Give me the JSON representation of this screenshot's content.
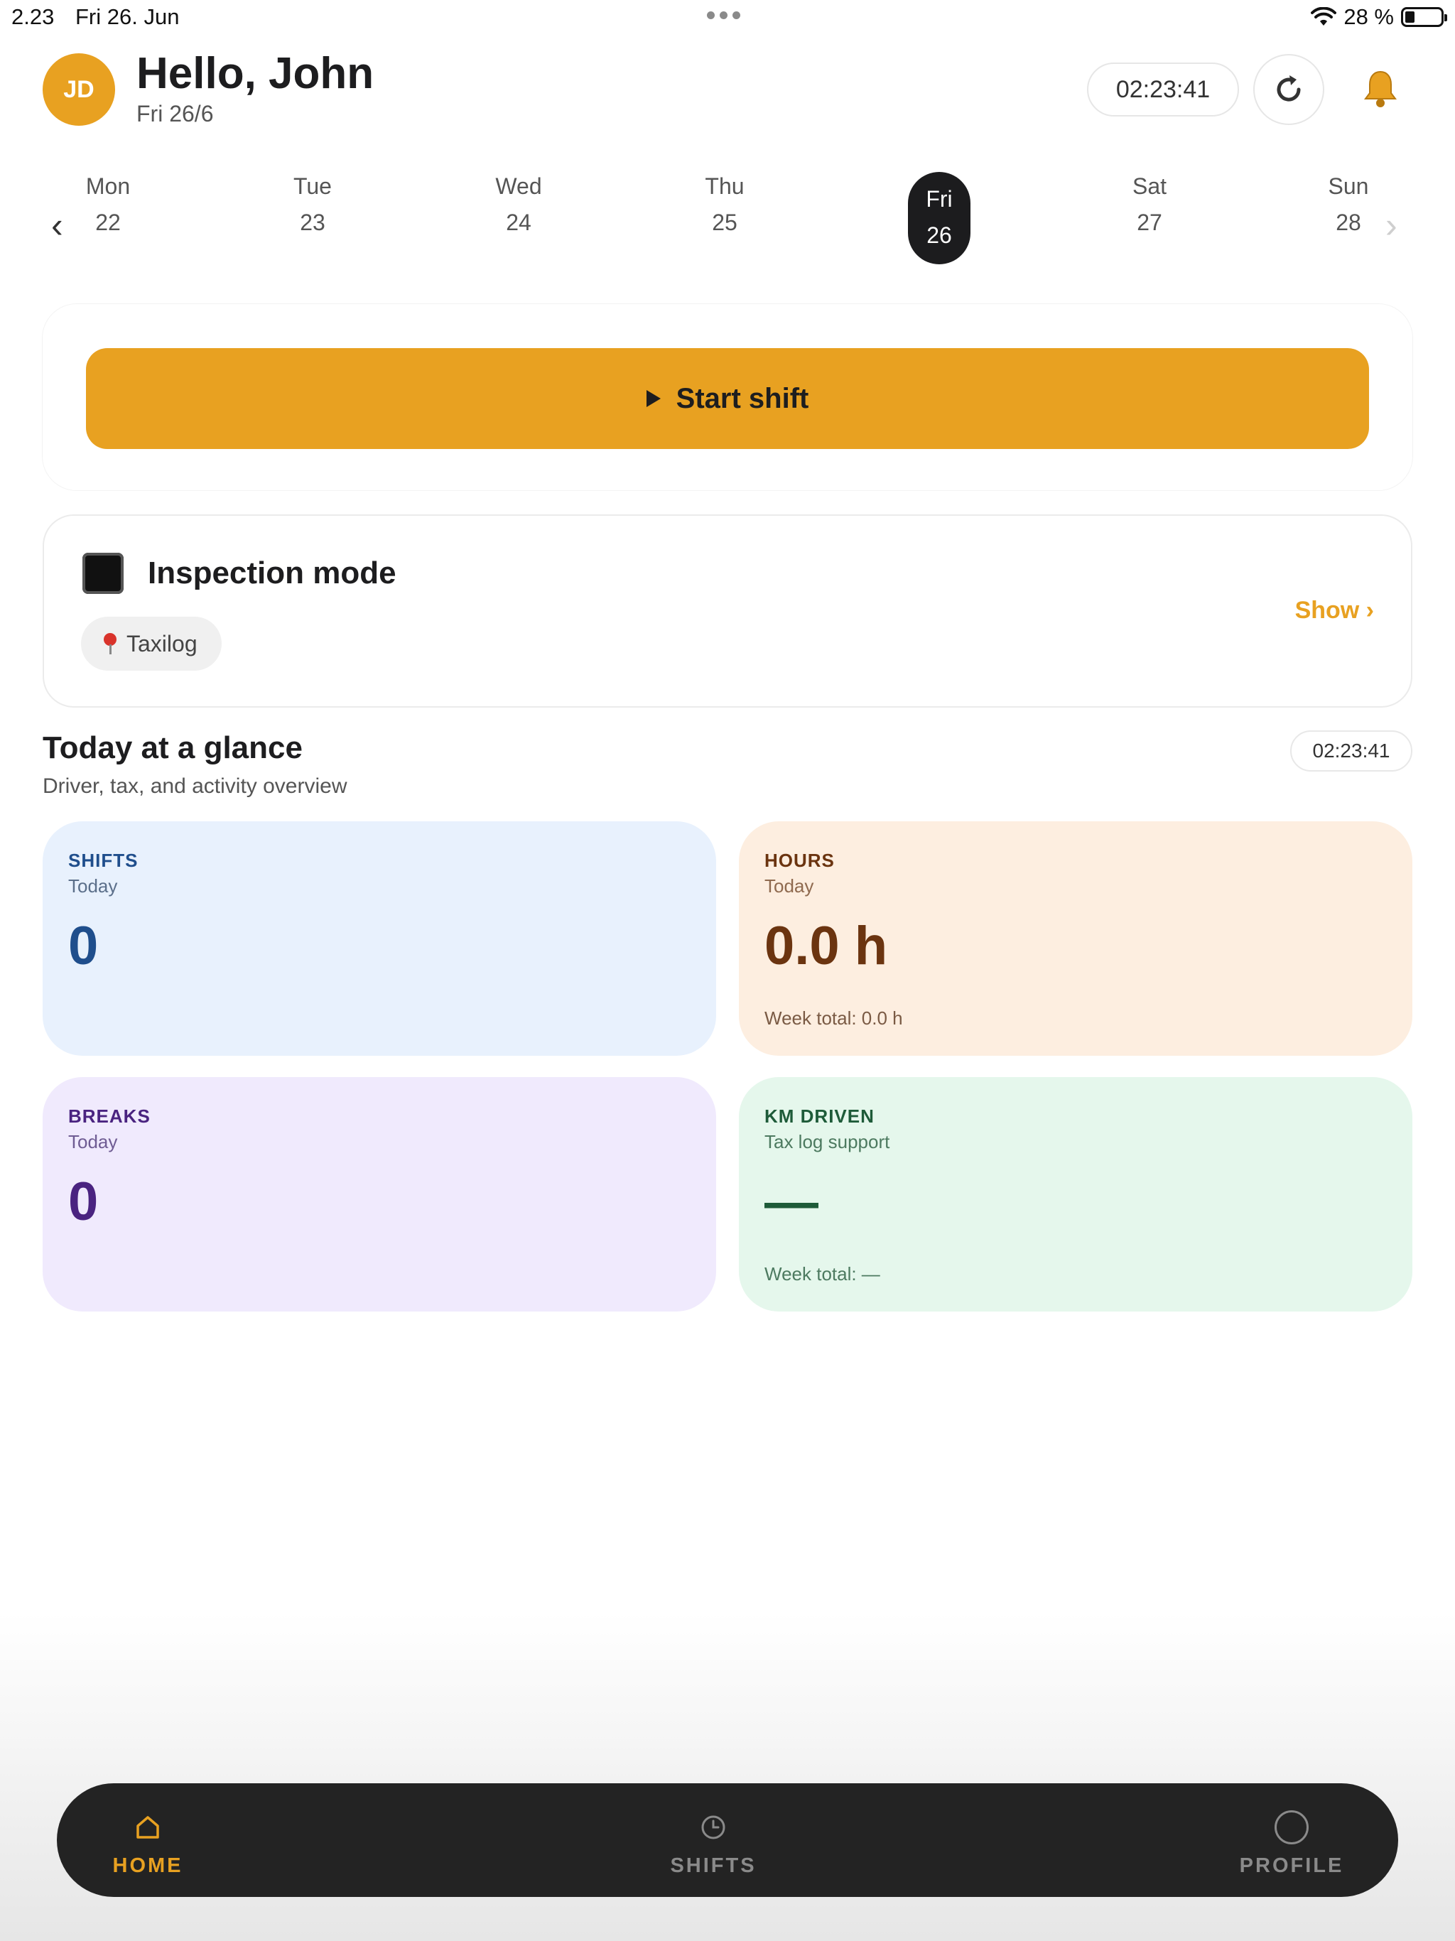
{
  "status_bar": {
    "time": "2.23",
    "date": "Fri 26. Jun",
    "battery": "28 %"
  },
  "header": {
    "avatar_initials": "JD",
    "greeting": "Hello, John",
    "date": "Fri 26/6",
    "timer": "02:23:41"
  },
  "week": {
    "days": [
      {
        "name": "Mon",
        "num": "22"
      },
      {
        "name": "Tue",
        "num": "23"
      },
      {
        "name": "Wed",
        "num": "24"
      },
      {
        "name": "Thu",
        "num": "25"
      },
      {
        "name": "Fri",
        "num": "26"
      },
      {
        "name": "Sat",
        "num": "27"
      },
      {
        "name": "Sun",
        "num": "28"
      }
    ],
    "selected_index": 4,
    "prev_arrow": "‹",
    "next_arrow": "›"
  },
  "shift": {
    "start_label": "Start shift"
  },
  "inspection": {
    "title": "Inspection mode",
    "location": "Taxilog",
    "show_label": "Show ›"
  },
  "glance": {
    "title": "Today at a glance",
    "subtitle": "Driver, tax, and activity overview",
    "timer": "02:23:41",
    "cards": {
      "shifts": {
        "label": "SHIFTS",
        "sub": "Today",
        "value": "0"
      },
      "hours": {
        "label": "HOURS",
        "sub": "Today",
        "value": "0.0 h",
        "foot": "Week total: 0.0 h"
      },
      "breaks": {
        "label": "BREAKS",
        "sub": "Today",
        "value": "0"
      },
      "km": {
        "label": "KM DRIVEN",
        "sub": "Tax log support",
        "value": "—",
        "foot": "Week total: —"
      }
    }
  },
  "nav": {
    "home": "HOME",
    "shifts": "SHIFTS",
    "profile": "PROFILE",
    "active": "home"
  },
  "colors": {
    "accent": "#e8a121",
    "dark": "#1c1c1e"
  },
  "icons": {
    "refresh": "refresh-icon",
    "bell": "bell-icon",
    "play": "play-icon",
    "stop": "stop-icon",
    "pin": "map-pin-icon",
    "home": "home-icon",
    "clock": "clock-icon",
    "profile": "profile-icon"
  }
}
